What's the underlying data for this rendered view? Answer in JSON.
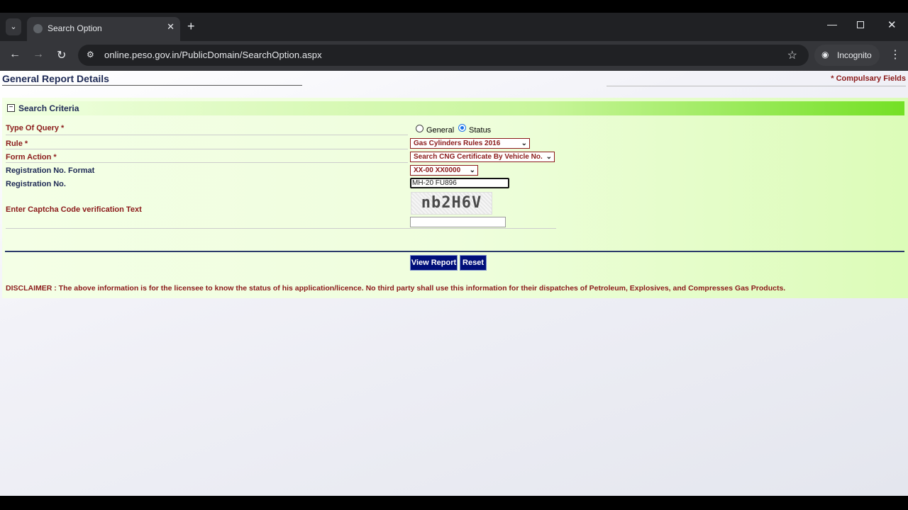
{
  "browser": {
    "tab_title": "Search Option",
    "url": "online.peso.gov.in/PublicDomain/SearchOption.aspx",
    "incognito_label": "Incognito"
  },
  "page": {
    "heading": "General Report Details",
    "compulsory_note": "* Compulsary Fields"
  },
  "form": {
    "section_title": "Search Criteria",
    "type_of_query": {
      "label": "Type Of Query *",
      "options": [
        "General",
        "Status"
      ],
      "selected": "Status"
    },
    "rule": {
      "label": "Rule *",
      "value": "Gas Cylinders Rules 2016"
    },
    "form_action": {
      "label": "Form Action *",
      "value": "Search CNG Certificate By Vehicle No."
    },
    "reg_format": {
      "label": "Registration No. Format",
      "value": "XX-00 XX0000"
    },
    "reg_no": {
      "label": "Registration No.",
      "value": "MH-20 FU896"
    },
    "captcha": {
      "label": "Enter Captcha Code verification Text",
      "image_text": "nb2H6V",
      "value": ""
    },
    "view_report_label": "View Report",
    "reset_label": "Reset"
  },
  "disclaimer": "DISCLAIMER : The above information is for the licensee to know the status of his application/licence. No third party shall use this information for their dispatches of Petroleum, Explosives, and Compresses Gas Products."
}
